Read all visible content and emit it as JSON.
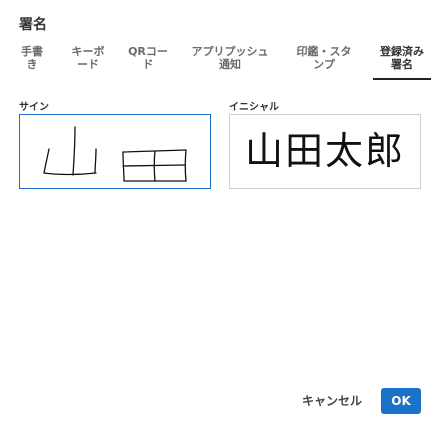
{
  "dialog": {
    "title": "署名"
  },
  "tabs": [
    {
      "line1": "手書",
      "line2": "き"
    },
    {
      "line1": "キーボ",
      "line2": "ード"
    },
    {
      "line1": "QRコー",
      "line2": "ド"
    },
    {
      "line1": "アプリプッシュ",
      "line2": "通知"
    },
    {
      "line1": "印鑑・スタ",
      "line2": "ンプ"
    },
    {
      "line1": "登録済み",
      "line2": "署名"
    }
  ],
  "active_tab_index": 5,
  "signature": {
    "label": "サイン",
    "handwritten_text": "山田"
  },
  "initial": {
    "label": "イニシャル",
    "text": "山田太郎"
  },
  "footer": {
    "cancel_label": "キャンセル",
    "ok_label": "OK"
  },
  "colors": {
    "accent": "#1a73c8",
    "active_underline": "#222222"
  }
}
